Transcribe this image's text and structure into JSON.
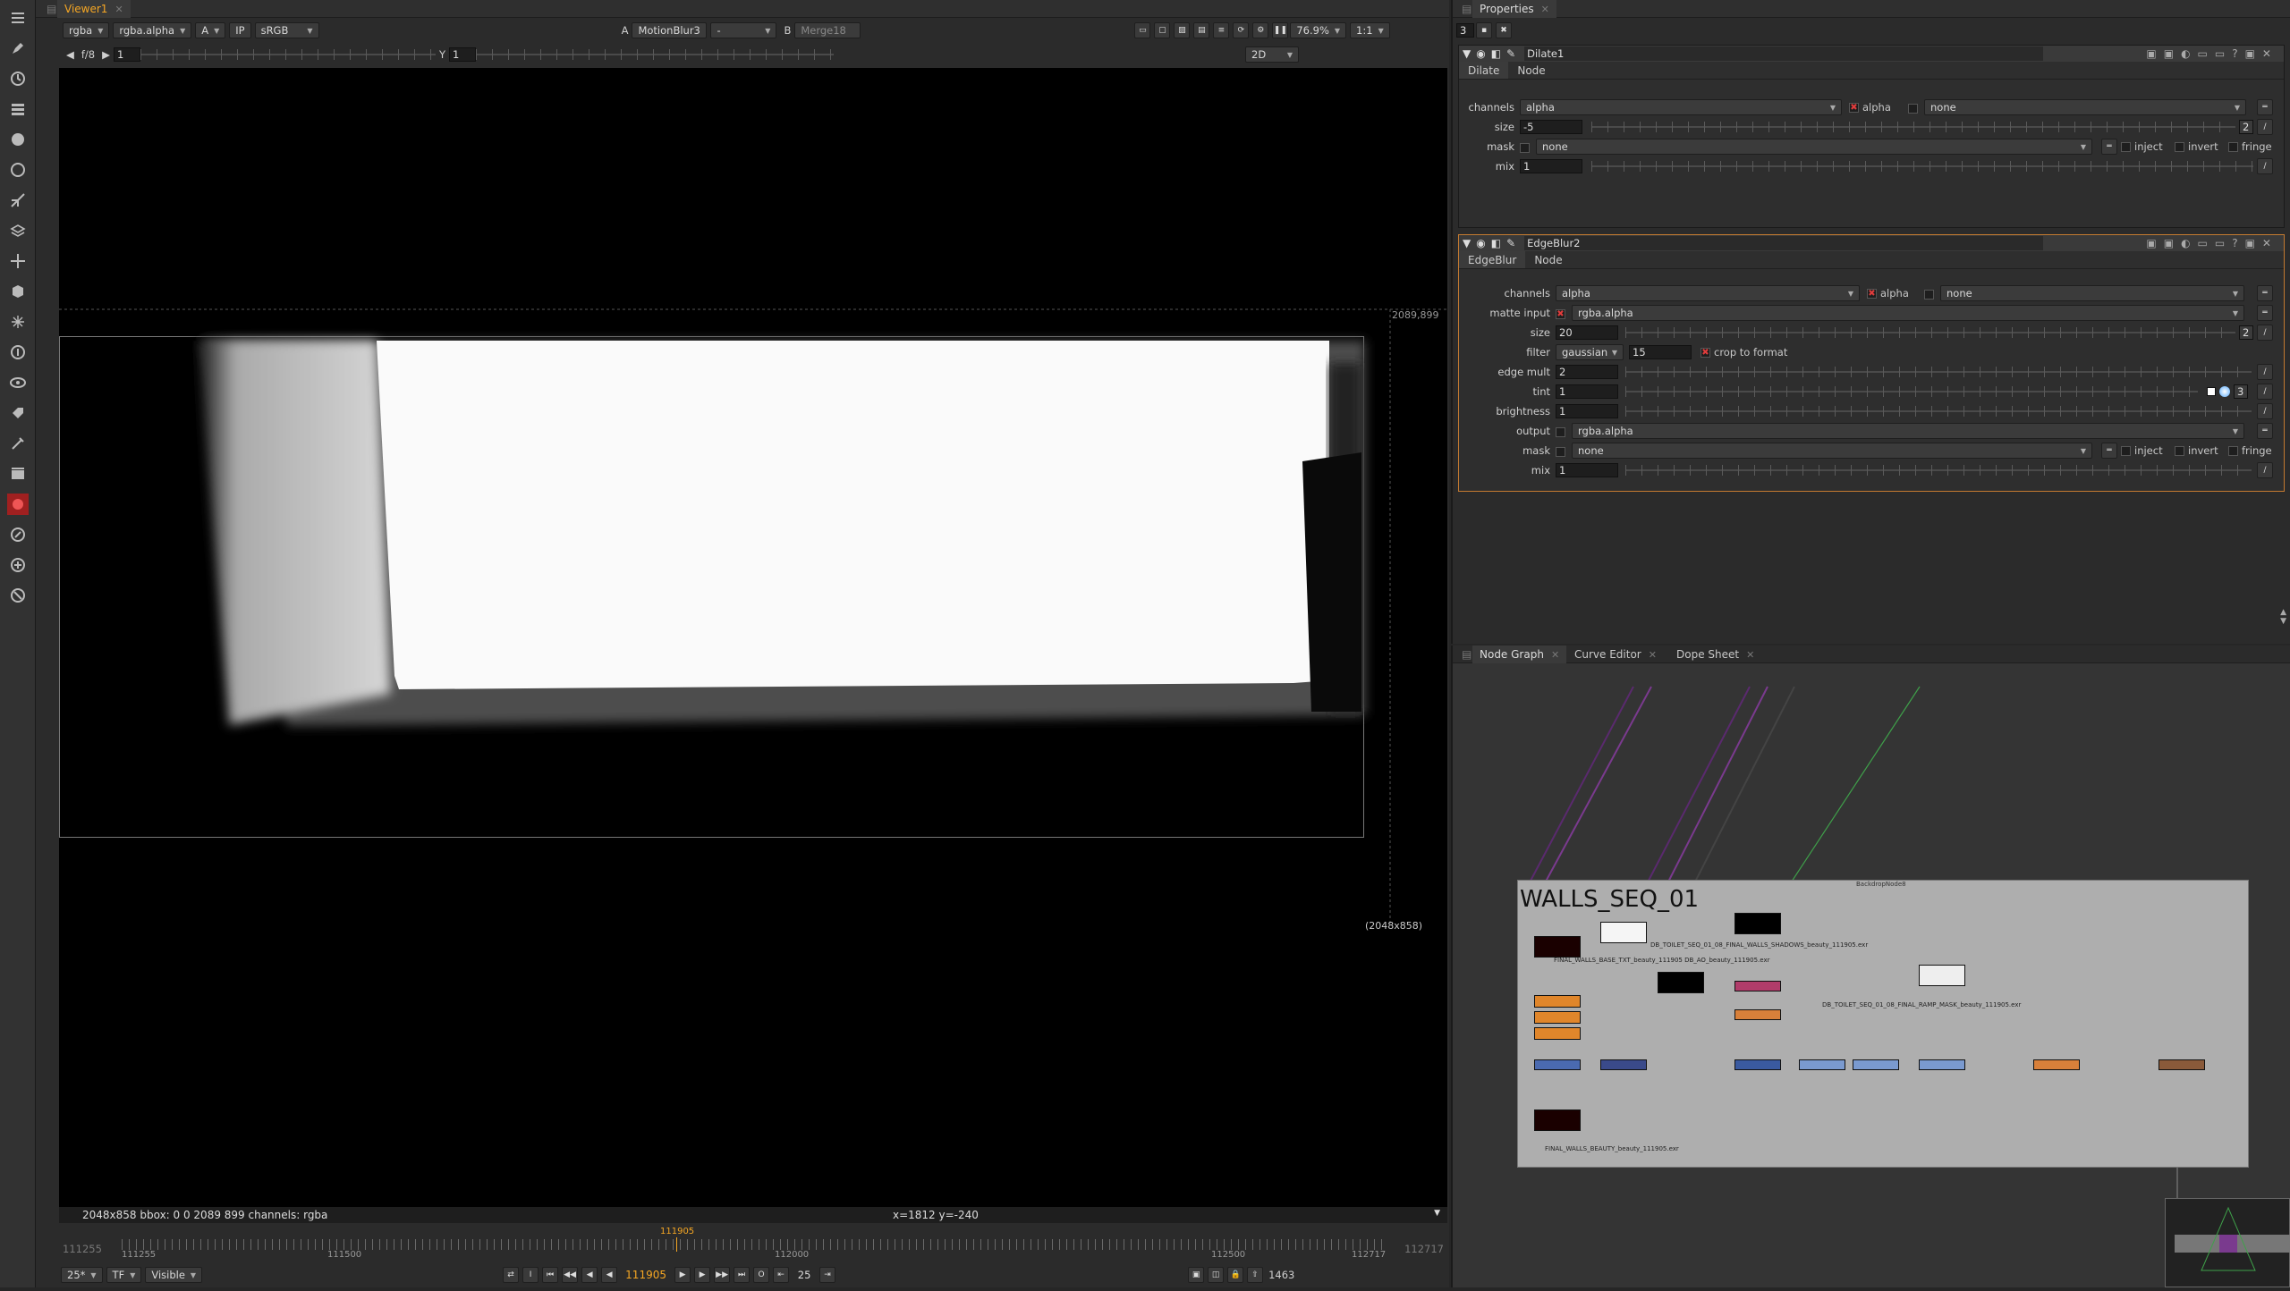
{
  "viewer": {
    "tab": "Viewer1",
    "controls": {
      "channels": "rgba",
      "layer": "rgba.alpha",
      "input_a": "A",
      "ip": "IP",
      "colorspace": "sRGB",
      "a_label": "A",
      "a_node": "MotionBlur3",
      "dash": "-",
      "b_label": "B",
      "b_node": "Merge18",
      "zoom": "76.9%",
      "ratio": "1:1"
    },
    "row2": {
      "fstop": "f/8",
      "frame_step": "1",
      "y_label": "Y",
      "y_value": "1",
      "mode": "2D"
    },
    "overlay": {
      "bbox_tr": "2089,899",
      "format_br": "(2048x858)"
    },
    "status": {
      "left": "2048x858  bbox: 0 0 2089 899 channels: rgba",
      "coords": "x=1812 y=-240"
    },
    "timeline": {
      "start": "111255",
      "end": "112717",
      "start_small": "111255",
      "end_small": "112717",
      "current_marker": "111905",
      "tick1": "111500",
      "tick2": "112000",
      "tick3": "112500"
    },
    "transport": {
      "fps": "25*",
      "tf": "TF",
      "visible": "Visible",
      "current_frame": "111905",
      "increment": "25",
      "end_frame": "1463"
    }
  },
  "properties": {
    "tab": "Properties",
    "count": "3",
    "dilate": {
      "title": "Dilate1",
      "tab1": "Dilate",
      "tab2": "Node",
      "channels_label": "channels",
      "channels_value": "alpha",
      "alpha_label": "alpha",
      "none_value": "none",
      "size_label": "size",
      "size_value": "-5",
      "size_count": "2",
      "mask_label": "mask",
      "mask_value": "none",
      "inject": "inject",
      "invert": "invert",
      "fringe": "fringe",
      "mix_label": "mix",
      "mix_value": "1"
    },
    "edgeblur": {
      "title": "EdgeBlur2",
      "tab1": "EdgeBlur",
      "tab2": "Node",
      "channels_label": "channels",
      "channels_value": "alpha",
      "alpha_label": "alpha",
      "none_value": "none",
      "matte_label": "matte input",
      "matte_value": "rgba.alpha",
      "size_label": "size",
      "size_value": "20",
      "size_count": "2",
      "filter_label": "filter",
      "filter_value": "gaussian",
      "filter_num": "15",
      "crop_label": "crop to format",
      "edge_label": "edge mult",
      "edge_value": "2",
      "tint_label": "tint",
      "tint_value": "1",
      "tint_count": "3",
      "brightness_label": "brightness",
      "brightness_value": "1",
      "output_label": "output",
      "output_value": "rgba.alpha",
      "mask_label": "mask",
      "mask_value": "none",
      "inject": "inject",
      "invert": "invert",
      "fringe": "fringe",
      "mix_label": "mix",
      "mix_value": "1"
    }
  },
  "nodegraph": {
    "tabs": [
      "Node Graph",
      "Curve Editor",
      "Dope Sheet"
    ],
    "backdrop_title": "WALLS_SEQ_01",
    "backdrop_small": "BackdropNode8",
    "labels": {
      "l1": "DB_TOILET_SEQ_01_08_FINAL_WALLS_SHADOWS_beauty_111905.exr",
      "l2": "FINAL_WALLS_BASE_TXT_beauty_111905 DB_AO_beauty_111905.exr",
      "l3": "DB_TOILET_SEQ_01_08_FINAL_RAMP_MASK_beauty_111905.exr",
      "l4": "FINAL_WALLS_BEAUTY_beauty_111905.exr"
    }
  }
}
